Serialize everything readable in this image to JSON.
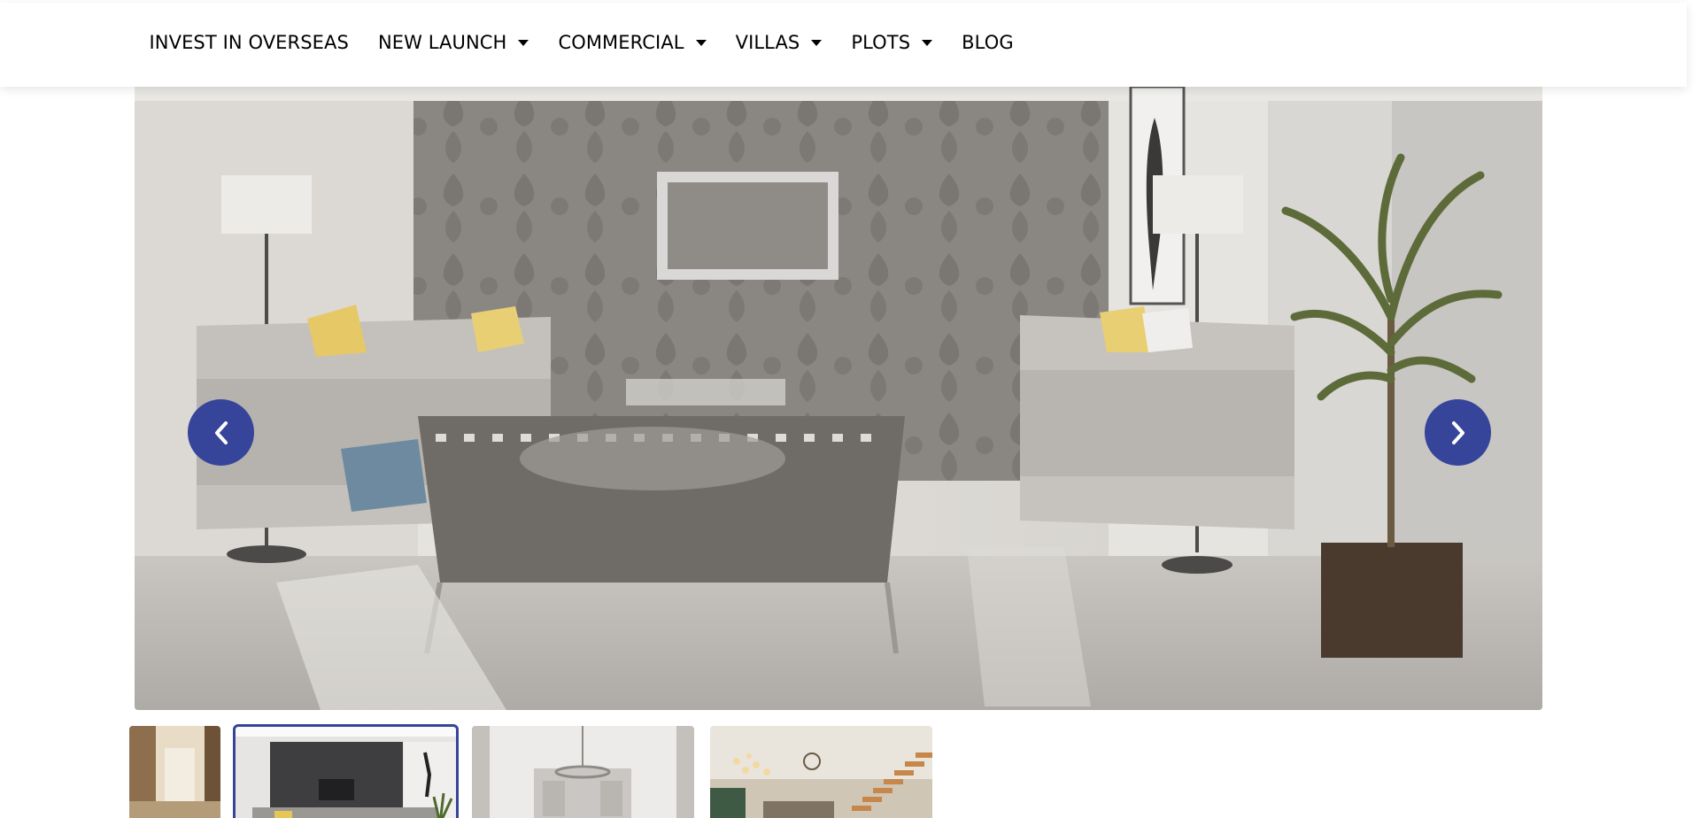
{
  "nav": {
    "items": [
      {
        "label": "INVEST IN OVERSEAS",
        "has_dropdown": false
      },
      {
        "label": "NEW LAUNCH",
        "has_dropdown": true
      },
      {
        "label": "COMMERCIAL",
        "has_dropdown": true
      },
      {
        "label": "VILLAS",
        "has_dropdown": true
      },
      {
        "label": "PLOTS",
        "has_dropdown": true
      },
      {
        "label": "BLOG",
        "has_dropdown": false
      }
    ]
  },
  "slider": {
    "image": "living-room-photo",
    "prev_icon": "chevron-left-icon",
    "next_icon": "chevron-right-icon",
    "accent_color": "#36459a"
  },
  "thumbnails": {
    "items": [
      {
        "image": "hallway-photo",
        "active": false
      },
      {
        "image": "living-room-photo",
        "active": true
      },
      {
        "image": "kitchen-photo",
        "active": false
      },
      {
        "image": "staircase-lounge-photo",
        "active": false
      }
    ]
  }
}
